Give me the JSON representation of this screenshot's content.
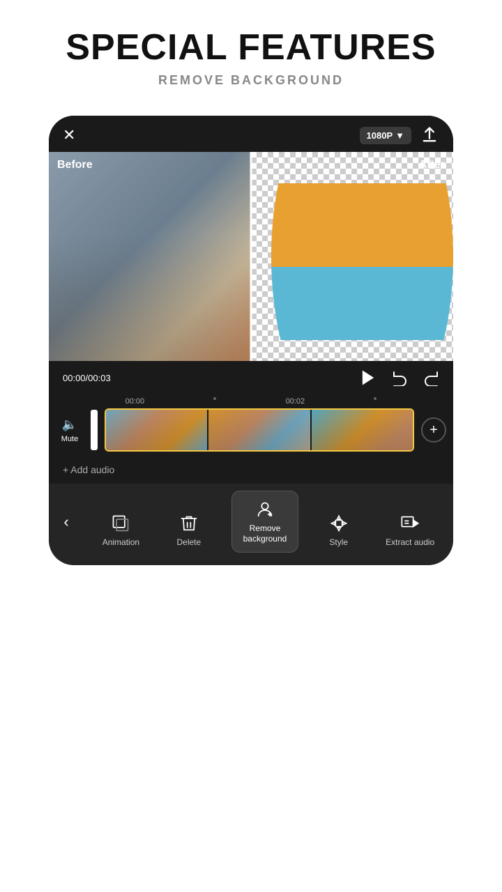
{
  "header": {
    "title": "SPECIAL FEATURES",
    "subtitle": "REMOVE BACKGROUND"
  },
  "topbar": {
    "close_label": "✕",
    "resolution": "1080P",
    "resolution_arrow": "▼",
    "export_icon": "upload-icon"
  },
  "preview": {
    "before_label": "Before",
    "after_label": "After"
  },
  "controls": {
    "time_display": "00:00/00:03",
    "play_icon": "play-icon",
    "undo_icon": "undo-icon",
    "redo_icon": "redo-icon"
  },
  "timeline": {
    "markers": [
      {
        "label": "00:00",
        "has_dot": false
      },
      {
        "label": "",
        "has_dot": true
      },
      {
        "label": "00:02",
        "has_dot": false
      },
      {
        "label": "",
        "has_dot": true
      }
    ]
  },
  "mute": {
    "icon": "🔈",
    "label": "Mute"
  },
  "add_audio": {
    "label": "+ Add audio"
  },
  "toolbar": {
    "back_icon": "‹",
    "items": [
      {
        "id": "animation",
        "label": "Animation",
        "icon": "animation-icon"
      },
      {
        "id": "delete",
        "label": "Delete",
        "icon": "delete-icon"
      },
      {
        "id": "remove-bg",
        "label": "Remove\nbackground",
        "icon": "remove-bg-icon",
        "active": true
      },
      {
        "id": "style",
        "label": "Style",
        "icon": "style-icon"
      },
      {
        "id": "extract-audio",
        "label": "Extract audio",
        "icon": "extract-audio-icon"
      }
    ]
  }
}
